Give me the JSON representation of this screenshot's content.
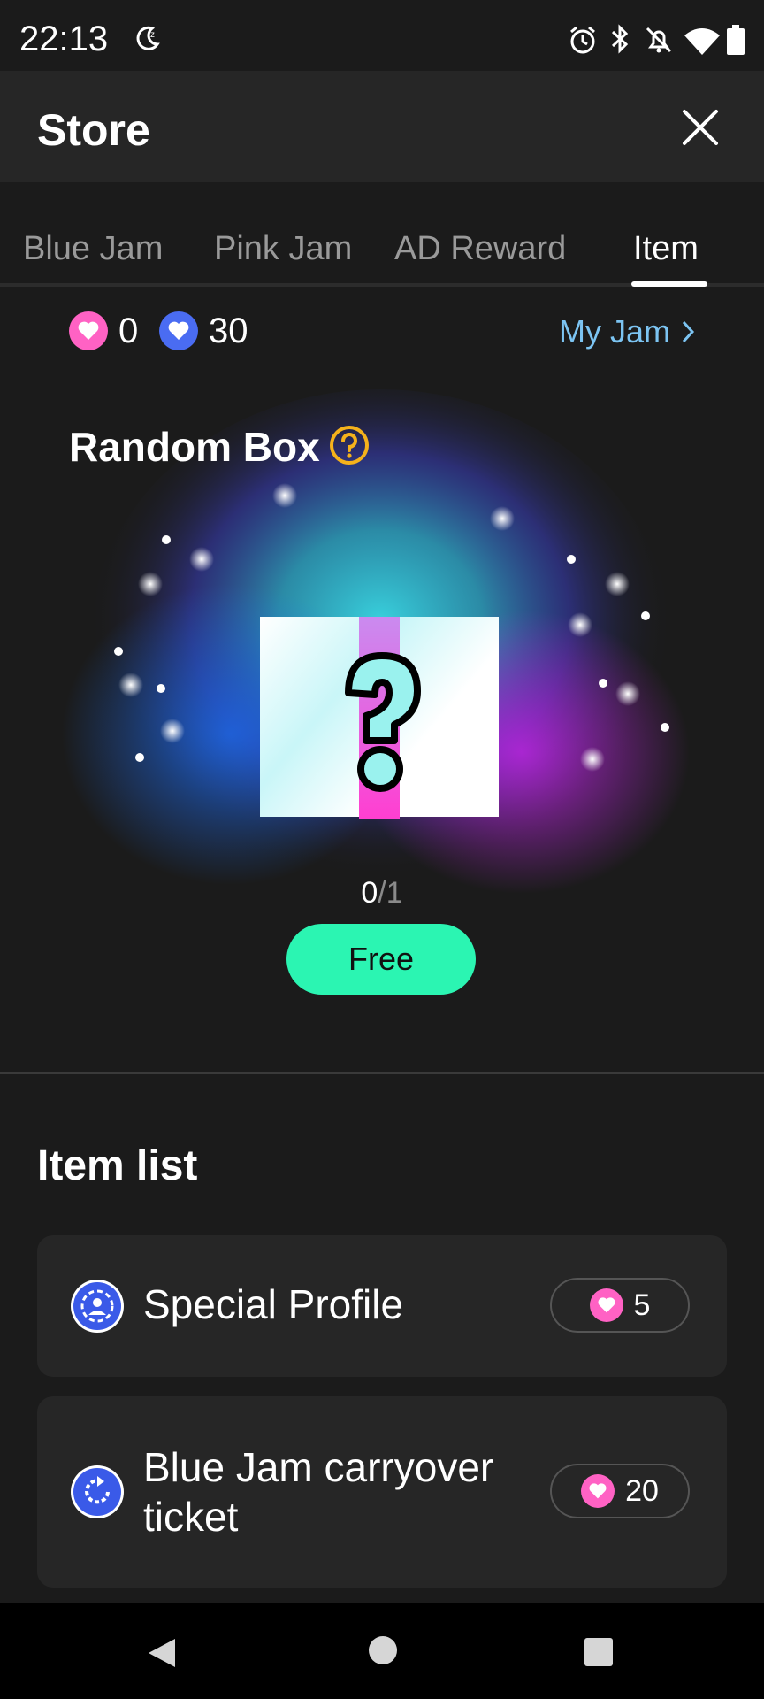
{
  "status_bar": {
    "time": "22:13"
  },
  "header": {
    "title": "Store"
  },
  "tabs": [
    {
      "label": "Blue Jam",
      "active": false
    },
    {
      "label": "Pink Jam",
      "active": false
    },
    {
      "label": "AD Reward",
      "active": false
    },
    {
      "label": "Item",
      "active": true
    }
  ],
  "balances": {
    "pink_jam": "0",
    "blue_jam": "30",
    "my_jam_label": "My Jam"
  },
  "random_box": {
    "title": "Random Box",
    "count_current": "0",
    "count_total": "/1",
    "button_label": "Free"
  },
  "item_list": {
    "title": "Item list",
    "items": [
      {
        "name": "Special Profile",
        "price": "5",
        "icon": "profile-icon"
      },
      {
        "name": "Blue Jam carryover ticket",
        "price": "20",
        "icon": "refresh-icon"
      }
    ]
  },
  "colors": {
    "pink_jam": "#ff62c4",
    "blue_jam": "#4a6cf2",
    "accent_green": "#2bf5b2",
    "link_blue": "#7cc4f2",
    "help_yellow": "#f5b21b"
  }
}
